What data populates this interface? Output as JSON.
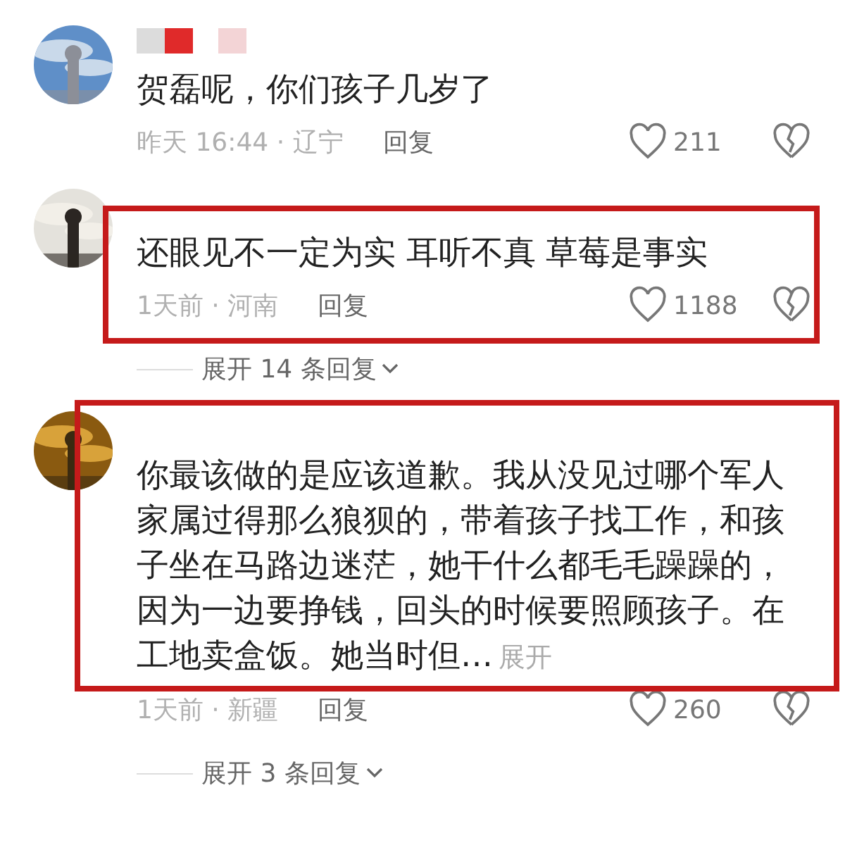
{
  "comments": [
    {
      "text": "贺磊呢，你们孩子几岁了",
      "time": "昨天 16:44",
      "sep": "·",
      "location": "辽宁",
      "reply": "回复",
      "likes": "211",
      "highlighted": false,
      "name_redacted": true
    },
    {
      "text": "还眼见不一定为实  耳听不真  草莓是事实",
      "time": "1天前",
      "sep": "·",
      "location": "河南",
      "reply": "回复",
      "likes": "1188",
      "highlighted": true,
      "name_redacted": false,
      "expand": "展开 14 条回复"
    },
    {
      "text": "你最该做的是应该道歉。我从没见过哪个军人家属过得那么狼狈的，带着孩子找工作，和孩子坐在马路边迷茫，她干什么都毛毛躁躁的，因为一边要挣钱，回头的时候要照顾孩子。在工地卖盒饭。她当时但…",
      "more": "展开",
      "time": "1天前",
      "sep": "·",
      "location": "新疆",
      "reply": "回复",
      "likes": "260",
      "highlighted": true,
      "name_redacted": false,
      "expand": "展开 3 条回复"
    }
  ]
}
